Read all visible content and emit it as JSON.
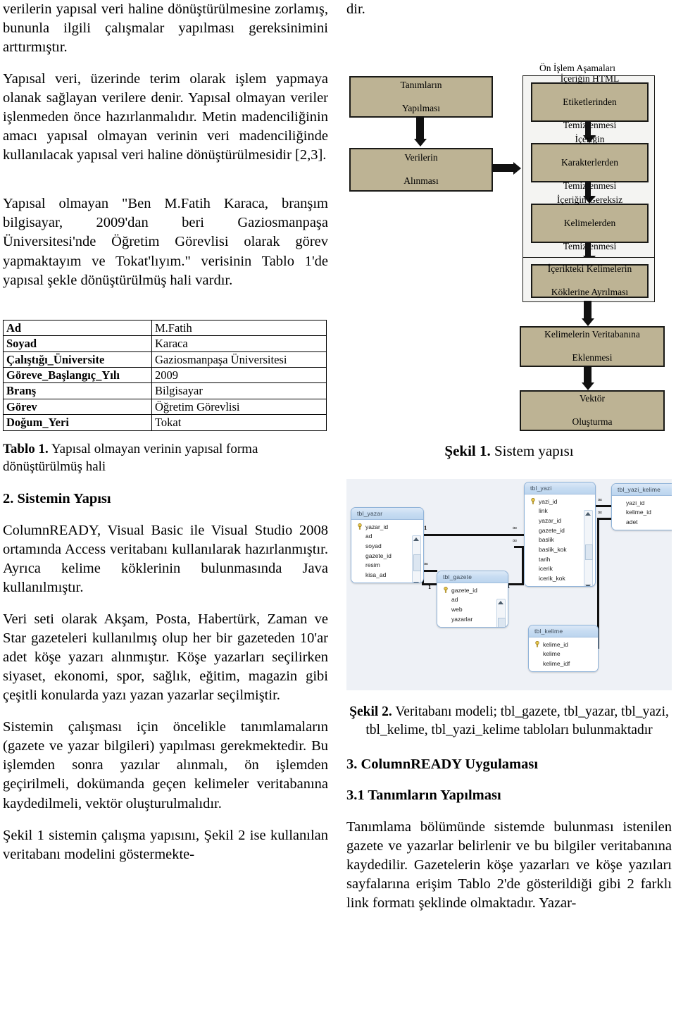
{
  "left_column": {
    "para1": "verilerin yapısal veri haline dönüştürülmesine zorlamış, bununla ilgili çalışmalar yapılması gereksinimini arttırmıştır.",
    "para2": "Yapısal veri, üzerinde terim olarak işlem yapmaya olanak sağlayan verilere denir. Yapısal olmayan veriler işlenmeden önce hazırlanmalıdır. Metin madenciliğinin amacı yapısal olmayan verinin veri madenciliğinde kullanılacak yapısal veri haline dönüştürülmesidir [2,3].",
    "para3": "Yapısal olmayan \"Ben M.Fatih Karaca, branşım bilgisayar, 2009'dan beri Gaziosmanpaşa Üniversitesi'nde Öğretim Görevlisi olarak görev yapmaktayım ve Tokat'lıyım.\" verisinin Tablo 1'de yapısal şekle dönüştürülmüş hali vardır.",
    "table1": {
      "rows": [
        {
          "key": "Ad",
          "value": "M.Fatih"
        },
        {
          "key": "Soyad",
          "value": "Karaca"
        },
        {
          "key": "Çalıştığı_Üniversite",
          "value": "Gaziosmanpaşa Üniversitesi"
        },
        {
          "key": "Göreve_Başlangıç_Yılı",
          "value": "2009"
        },
        {
          "key": "Branş",
          "value": "Bilgisayar"
        },
        {
          "key": "Görev",
          "value": "Öğretim Görevlisi"
        },
        {
          "key": "Doğum_Yeri",
          "value": "Tokat"
        }
      ]
    },
    "table1_caption_label": "Tablo 1.",
    "table1_caption_text": " Yapısal olmayan verinin yapısal forma dönüştürülmüş hali",
    "heading2": "2. Sistemin Yapısı",
    "para4": "ColumnREADY, Visual Basic ile Visual Studio 2008 ortamında Access veritabanı kullanılarak hazırlanmıştır. Ayrıca kelime köklerinin bulunmasında Java kullanılmıştır.",
    "para5": "Veri seti olarak Akşam, Posta, Habertürk, Zaman ve Star gazeteleri kullanılmış olup her bir gazeteden 10'ar adet köşe yazarı alınmıştır. Köşe yazarları seçilirken siyaset, ekonomi, spor, sağlık, eğitim, magazin gibi çeşitli konularda yazı yazan yazarlar seçilmiştir.",
    "para6": "Sistemin çalışması için öncelikle tanımlamaların (gazete ve yazar bilgileri) yapılması gerekmektedir. Bu işlemden sonra yazılar alınmalı, ön işlemden geçirilmeli, dokümanda geçen kelimeler veritabanına kaydedilmeli, vektör oluşturulmalıdır.",
    "para7": "Şekil 1 sistemin çalışma yapısını, Şekil 2 ise kullanılan veritabanı modelini göstermekte-"
  },
  "right_column": {
    "para_top": "dir.",
    "figure1": {
      "group_label": "Ön İşlem Aşamaları",
      "boxes": [
        {
          "id": "tanimlarin-yapilmasi",
          "lines": [
            "Tanımların",
            "Yapılması"
          ]
        },
        {
          "id": "verilerin-alinmasi",
          "lines": [
            "Verilerin",
            "Alınması"
          ]
        },
        {
          "id": "icerigin-html-etiketlerinden-temizlenmesi",
          "lines": [
            "İçeriğin HTML",
            "Etiketlerinden",
            "Temizlenmesi"
          ]
        },
        {
          "id": "icerigin-karakterlerden-temizlenmesi",
          "lines": [
            "İçeriğin",
            "Karakterlerden",
            "Temizlenmesi"
          ]
        },
        {
          "id": "icerigin-gereksiz-kelimelerden-temizlenmesi",
          "lines": [
            "İçeriğin Gereksiz",
            "Kelimelerden",
            "Temizlenmesi"
          ]
        },
        {
          "id": "icerikteki-kelimelerin-koklerine-ayrilmasi",
          "lines": [
            "İçerikteki Kelimelerin",
            "Köklerine Ayrılması"
          ]
        },
        {
          "id": "kelimelerin-veritabanina-eklenmesi",
          "lines": [
            "Kelimelerin Veritabanına",
            "Eklenmesi"
          ]
        },
        {
          "id": "vektor-olusturma",
          "lines": [
            "Vektör",
            "Oluşturma"
          ]
        }
      ],
      "box_fill": "#bdb394",
      "group_fill": "#f4f4f2",
      "border_color": "#1a1a17",
      "caption_label": "Şekil 1.",
      "caption_text": " Sistem yapısı"
    },
    "figure2": {
      "tables": [
        {
          "name": "tbl_yazar",
          "fields": [
            "yazar_id",
            "ad",
            "soyad",
            "gazete_id",
            "resim",
            "kisa_ad"
          ],
          "pk": "yazar_id",
          "scrollbar": true
        },
        {
          "name": "tbl_gazete",
          "fields": [
            "gazete_id",
            "ad",
            "web",
            "yazarlar"
          ],
          "pk": "gazete_id",
          "scrollbar": true
        },
        {
          "name": "tbl_yazi",
          "fields": [
            "yazi_id",
            "link",
            "yazar_id",
            "gazete_id",
            "baslik",
            "baslik_kok",
            "tarih",
            "icerik",
            "icerik_kok"
          ],
          "pk": "yazi_id",
          "scrollbar": true
        },
        {
          "name": "tbl_yazi_kelime",
          "fields": [
            "yazi_id",
            "kelime_id",
            "adet"
          ],
          "pk": null,
          "scrollbar": false
        },
        {
          "name": "tbl_kelime",
          "fields": [
            "kelime_id",
            "kelime",
            "kelime_idf"
          ],
          "pk": "kelime_id",
          "scrollbar": false
        }
      ],
      "cardinalities": [
        "1",
        "∞",
        "∞",
        "1",
        "∞",
        "1",
        "1",
        "∞",
        "∞",
        "1"
      ],
      "caption_label": "Şekil 2.",
      "caption_text": " Veritabanı modeli; tbl_gazete, tbl_yazar, tbl_yazi, tbl_kelime, tbl_yazi_kelime tabloları bulunmaktadır"
    },
    "heading3": "3. ColumnREADY Uygulaması",
    "heading31": "3.1 Tanımların Yapılması",
    "para_bottom": "Tanımlama bölümünde sistemde bulunması istenilen gazete ve yazarlar belirlenir ve bu bilgiler veritabanına kaydedilir. Gazetelerin köşe yazarları ve köşe yazıları sayfalarına erişim Tablo 2'de gösterildiği gibi 2 farklı link formatı şeklinde olmaktadır. Yazar-"
  }
}
